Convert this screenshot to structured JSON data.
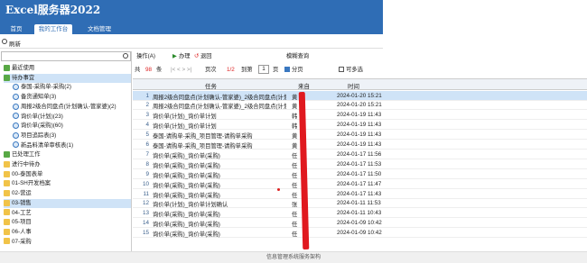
{
  "app": {
    "title": "Excel服务器2022"
  },
  "nav": {
    "tabs": [
      "首页",
      "我的工作台",
      "文档管理"
    ],
    "active": 1
  },
  "refresh_label": "刷新",
  "sidebar": {
    "items": [
      {
        "label": "最近使用",
        "icon": "green"
      },
      {
        "label": "待办事宜",
        "icon": "green",
        "selected": true
      },
      {
        "label": "泰国-采购单-采购(2)",
        "icon": "blue"
      },
      {
        "label": "备货通知单(3)",
        "icon": "blue"
      },
      {
        "label": "周报2级合同盘点(计划确认-管家婆)(2)",
        "icon": "blue"
      },
      {
        "label": "询价单(计划)(23)",
        "icon": "blue"
      },
      {
        "label": "询价单(采购)(60)",
        "icon": "blue"
      },
      {
        "label": "项目追踪表(3)",
        "icon": "blue"
      },
      {
        "label": "新品料清单审核表(1)",
        "icon": "blue"
      },
      {
        "label": "已处理工作",
        "icon": "green"
      },
      {
        "label": "进行中待办",
        "icon": "folder"
      },
      {
        "label": "00-泰国表单",
        "icon": "folder"
      },
      {
        "label": "01-SH开发档案",
        "icon": "folder"
      },
      {
        "label": "02-营运",
        "icon": "folder"
      },
      {
        "label": "03-销售",
        "icon": "folder",
        "selected": true
      },
      {
        "label": "04-工艺",
        "icon": "folder"
      },
      {
        "label": "05-项目",
        "icon": "folder"
      },
      {
        "label": "06-人事",
        "icon": "folder"
      },
      {
        "label": "07-采购",
        "icon": "folder"
      }
    ]
  },
  "toolbar": {
    "ops": "操作(A)",
    "handle": "办理",
    "back": "退回",
    "query": "模糊查询",
    "total_prefix": "共",
    "total": "98",
    "total_suffix": "条",
    "page_label": "页次",
    "page": "1/2",
    "goto": "到第",
    "goto_value": "1",
    "page_unit": "页",
    "paging": "分页",
    "multi": "可多选"
  },
  "grid": {
    "headers": [
      "任务",
      "来自",
      "时间"
    ],
    "rows": [
      {
        "n": "1",
        "task": "周报2级合同盘点(计划确认-管家婆)_2级合同盘点(计划确认",
        "from": "黄",
        "time": "2024-01-20 15:21",
        "selected": true
      },
      {
        "n": "2",
        "task": "周报2级合同盘点(计划确认-管家婆)_2级合同盘点(计划确认",
        "from": "黄",
        "time": "2024-01-20 15:21"
      },
      {
        "n": "3",
        "task": "询价单(计划)_询价单计划",
        "from": "韩",
        "time": "2024-01-19 11:43"
      },
      {
        "n": "4",
        "task": "询价单(计划)_询价单计划",
        "from": "韩",
        "time": "2024-01-19 11:43"
      },
      {
        "n": "5",
        "task": "泰国-请购单-采购_项目管理-请购单采购",
        "from": "黄",
        "time": "2024-01-19 11:43"
      },
      {
        "n": "6",
        "task": "泰国-请购单-采购_项目管理-请购单采购",
        "from": "黄",
        "time": "2024-01-19 11:43"
      },
      {
        "n": "7",
        "task": "询价单(采购)_询价单(采购)",
        "from": "任",
        "time": "2024-01-17 11:56"
      },
      {
        "n": "8",
        "task": "询价单(采购)_询价单(采购)",
        "from": "任",
        "time": "2024-01-17 11:53"
      },
      {
        "n": "9",
        "task": "询价单(采购)_询价单(采购)",
        "from": "任",
        "time": "2024-01-17 11:50"
      },
      {
        "n": "10",
        "task": "询价单(采购)_询价单(采购)",
        "from": "任",
        "time": "2024-01-17 11:47"
      },
      {
        "n": "11",
        "task": "询价单(采购)_询价单(采购)",
        "from": "任",
        "time": "2024-01-17 11:43"
      },
      {
        "n": "12",
        "task": "询价单(计划)_询价单计划确认",
        "from": "张",
        "time": "2024-01-11 11:53"
      },
      {
        "n": "13",
        "task": "询价单(采购)_询价单(采购)",
        "from": "任",
        "time": "2024-01-11 10:43"
      },
      {
        "n": "14",
        "task": "询价单(采购)_询价单(采购)",
        "from": "任",
        "time": "2024-01-09 10:42"
      },
      {
        "n": "15",
        "task": "询价单(采购)_询价单(采购)",
        "from": "任",
        "time": "2024-01-09 10:42"
      }
    ]
  },
  "footer": "信息管理系统服务架构"
}
